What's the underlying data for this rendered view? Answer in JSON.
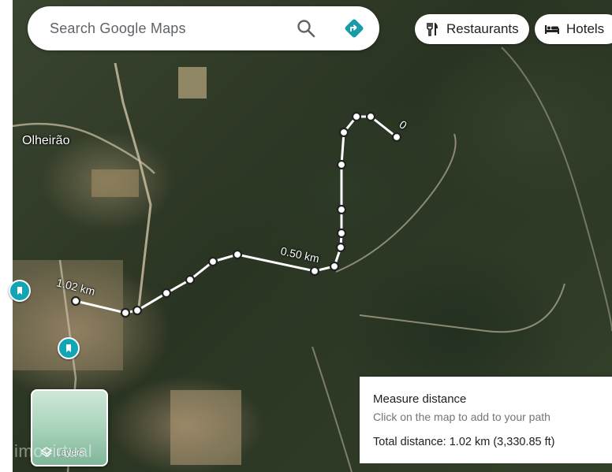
{
  "search": {
    "placeholder": "Search Google Maps"
  },
  "chips": {
    "restaurants": "Restaurants",
    "hotels": "Hotels"
  },
  "map": {
    "place_label": "Olheirão",
    "distance_labels": {
      "start": "0",
      "mid": "0.50 km",
      "end": "1.02 km"
    }
  },
  "measure_panel": {
    "title": "Measure distance",
    "hint": "Click on the map to add to your path",
    "total": "Total distance: 1.02 km (3,330.85 ft)"
  },
  "layers": {
    "label": "Layers"
  },
  "watermark": "imovirtual",
  "colors": {
    "poi_teal": "#12a5b5",
    "path": "#ffffff",
    "directions_teal": "#1a9ba8"
  }
}
